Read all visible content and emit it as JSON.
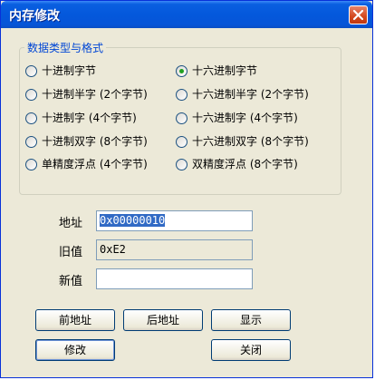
{
  "window": {
    "title": "内存修改"
  },
  "group": {
    "legend": "数据类型与格式",
    "options": [
      {
        "label": "十进制字节",
        "selected": false
      },
      {
        "label": "十六进制字节",
        "selected": true
      },
      {
        "label": "十进制半字 (2个字节)",
        "selected": false
      },
      {
        "label": "十六进制半字 (2个字节)",
        "selected": false
      },
      {
        "label": "十进制字 (4个字节)",
        "selected": false
      },
      {
        "label": "十六进制字 (4个字节)",
        "selected": false
      },
      {
        "label": "十进制双字 (8个字节)",
        "selected": false
      },
      {
        "label": "十六进制双字 (8个字节)",
        "selected": false
      },
      {
        "label": "单精度浮点 (4个字节)",
        "selected": false
      },
      {
        "label": "双精度浮点 (8个字节)",
        "selected": false
      }
    ]
  },
  "fields": {
    "address_label": "地址",
    "address_value": "0x00000010",
    "old_label": "旧值",
    "old_value": "0xE2",
    "new_label": "新值",
    "new_value": ""
  },
  "buttons": {
    "prev": "前地址",
    "next": "后地址",
    "show": "显示",
    "modify": "修改",
    "close": "关闭"
  }
}
